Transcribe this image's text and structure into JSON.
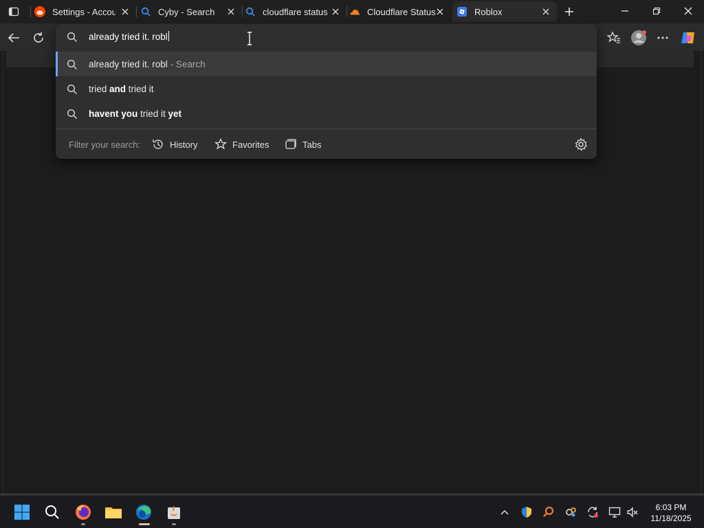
{
  "tabs": [
    {
      "title": "Settings - Accour",
      "icon": "reddit-icon"
    },
    {
      "title": "Cyby - Search",
      "icon": "search-icon"
    },
    {
      "title": "cloudflare status",
      "icon": "search-icon"
    },
    {
      "title": "Cloudflare Status",
      "icon": "cloudflare-icon"
    },
    {
      "title": "Roblox",
      "icon": "roblox-icon",
      "active": true
    }
  ],
  "omnibox": {
    "input_value": "already tried it. robl",
    "suggestions": [
      {
        "main": "already tried it. robl",
        "suffix": " - Search"
      },
      {
        "pre": "tried ",
        "bold": "and",
        "post": " tried it"
      },
      {
        "bold1": "havent you",
        "mid": " tried it ",
        "bold2": "yet"
      }
    ],
    "filter": {
      "label": "Filter your search:",
      "history": "History",
      "favorites": "Favorites",
      "tabs": "Tabs"
    }
  },
  "clock": {
    "time": "6:03 PM",
    "date": "11/18/2025"
  },
  "colors": {
    "accent": "#6aa6ff",
    "bg": "#1c1c1c"
  }
}
